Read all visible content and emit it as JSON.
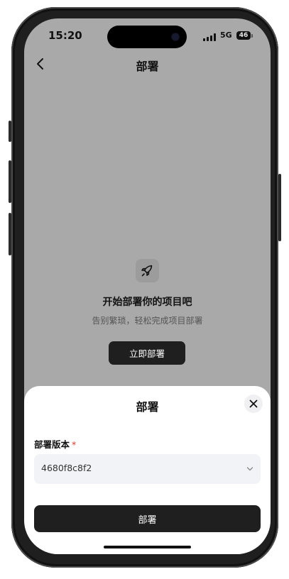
{
  "status_bar": {
    "time": "15:20",
    "network": "5G",
    "battery": "46"
  },
  "nav": {
    "title": "部署",
    "back_icon": "chevron-left-icon"
  },
  "empty_state": {
    "icon": "rocket-icon",
    "title": "开始部署你的项目吧",
    "subtitle": "告别繁琐，轻松完成项目部署",
    "button_label": "立即部署"
  },
  "sheet": {
    "title": "部署",
    "close_icon": "close-icon",
    "field_label": "部署版本",
    "required_mark": "*",
    "version_value": "4680f8c8f2",
    "submit_label": "部署"
  }
}
